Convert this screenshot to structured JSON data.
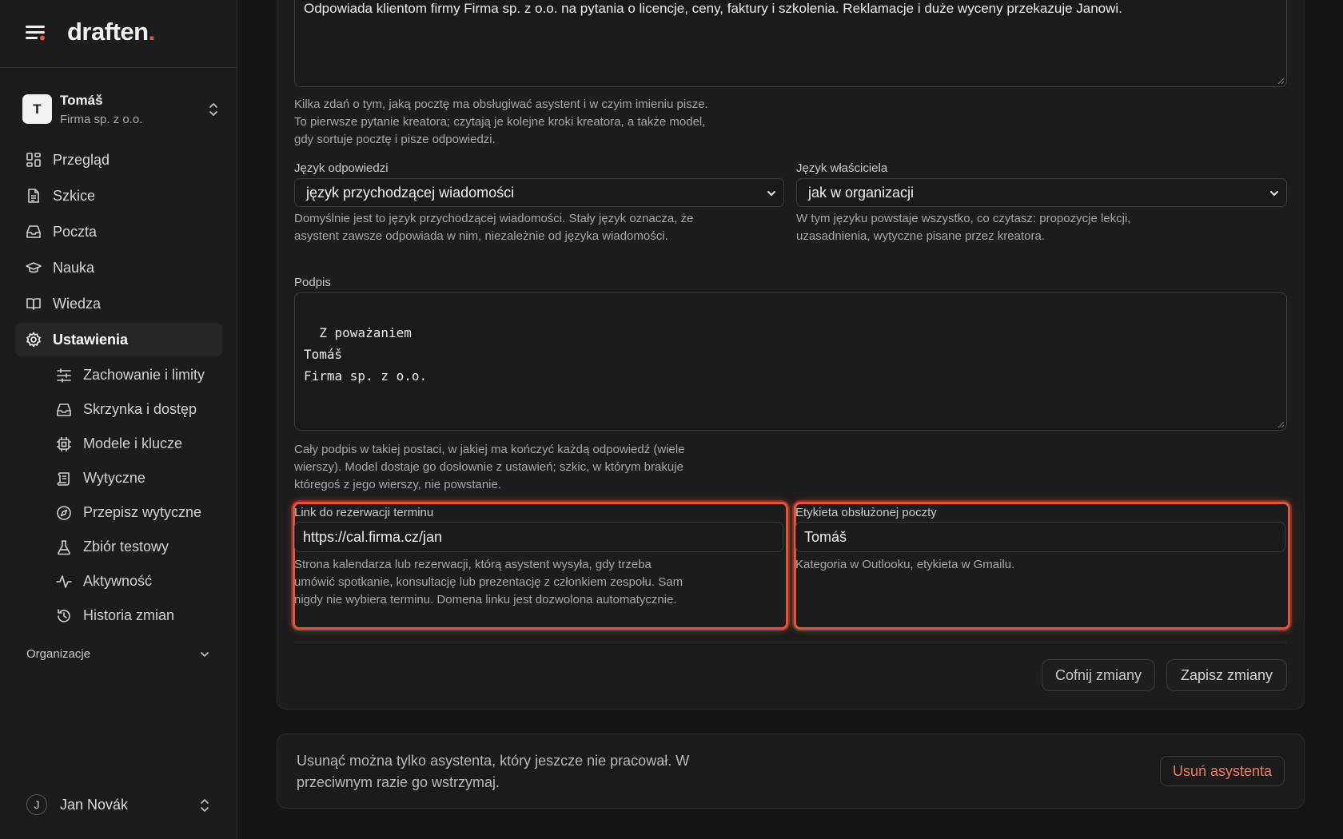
{
  "brand": {
    "logo_text": "draften",
    "logo_dot": ".",
    "accent_color": "#e5533d"
  },
  "org_switcher": {
    "initial": "T",
    "name": "Tomáš",
    "company": "Firma sp. z o.o."
  },
  "nav": {
    "items": [
      {
        "label": "Przegląd",
        "icon": "grid-icon"
      },
      {
        "label": "Szkice",
        "icon": "file-icon"
      },
      {
        "label": "Poczta",
        "icon": "inbox-icon"
      },
      {
        "label": "Nauka",
        "icon": "graduation-cap-icon"
      },
      {
        "label": "Wiedza",
        "icon": "book-icon"
      },
      {
        "label": "Ustawienia",
        "icon": "gear-icon",
        "active": true
      }
    ],
    "sub_items": [
      {
        "label": "Zachowanie i limity",
        "icon": "sliders-icon"
      },
      {
        "label": "Skrzynka i dostęp",
        "icon": "inbox-icon"
      },
      {
        "label": "Modele i klucze",
        "icon": "chip-icon"
      },
      {
        "label": "Wytyczne",
        "icon": "scroll-icon"
      },
      {
        "label": "Przepisz wytyczne",
        "icon": "compass-icon"
      },
      {
        "label": "Zbiór testowy",
        "icon": "flask-icon"
      },
      {
        "label": "Aktywność",
        "icon": "activity-icon"
      },
      {
        "label": "Historia zmian",
        "icon": "history-icon"
      }
    ]
  },
  "organizations": {
    "label": "Organizacje"
  },
  "user": {
    "initial": "J",
    "name": "Jan Novák"
  },
  "form": {
    "description": {
      "value": "Odpowiada klientom firmy Firma sp. z o.o. na pytania o licencje, ceny, faktury i szkolenia. Reklamacje i duże wyceny przekazuje Janowi.",
      "help": "Kilka zdań o tym, jaką pocztę ma obsługiwać asystent i w czyim imieniu pisze. To pierwsze pytanie kreatora; czytają je kolejne kroki kreatora, a także model, gdy sortuje pocztę i pisze odpowiedzi."
    },
    "reply_language": {
      "label": "Język odpowiedzi",
      "value": "język przychodzącej wiadomości",
      "help": "Domyślnie jest to język przychodzącej wiadomości. Stały język oznacza, że asystent zawsze odpowiada w nim, niezależnie od języka wiadomości."
    },
    "owner_language": {
      "label": "Język właściciela",
      "value": "jak w organizacji",
      "help": "W tym języku powstaje wszystko, co czytasz: propozycje lekcji, uzasadnienia, wytyczne pisane przez kreatora."
    },
    "signature": {
      "label": "Podpis",
      "value": "Z poważaniem\nTomáš\nFirma sp. z o.o.",
      "help": "Cały podpis w takiej postaci, w jakiej ma kończyć każdą odpowiedź (wiele wierszy). Model dostaje go dosłownie z ustawień; szkic, w którym brakuje któregoś z jego wierszy, nie powstanie."
    },
    "booking_link": {
      "label": "Link do rezerwacji terminu",
      "value": "https://cal.firma.cz/jan",
      "help": "Strona kalendarza lub rezerwacji, którą asystent wysyła, gdy trzeba umówić spotkanie, konsultację lub prezentację z członkiem zespołu. Sam nigdy nie wybiera terminu. Domena linku jest dozwolona automatycznie."
    },
    "handled_label": {
      "label": "Etykieta obsłużonej poczty",
      "value": "Tomáš",
      "help": "Kategoria w Outlooku, etykieta w Gmailu."
    },
    "revert_button": "Cofnij zmiany",
    "save_button": "Zapisz zmiany"
  },
  "danger_zone": {
    "text": "Usunąć można tylko asystenta, który jeszcze nie pracował. W przeciwnym razie go wstrzymaj.",
    "button": "Usuń asystenta"
  }
}
